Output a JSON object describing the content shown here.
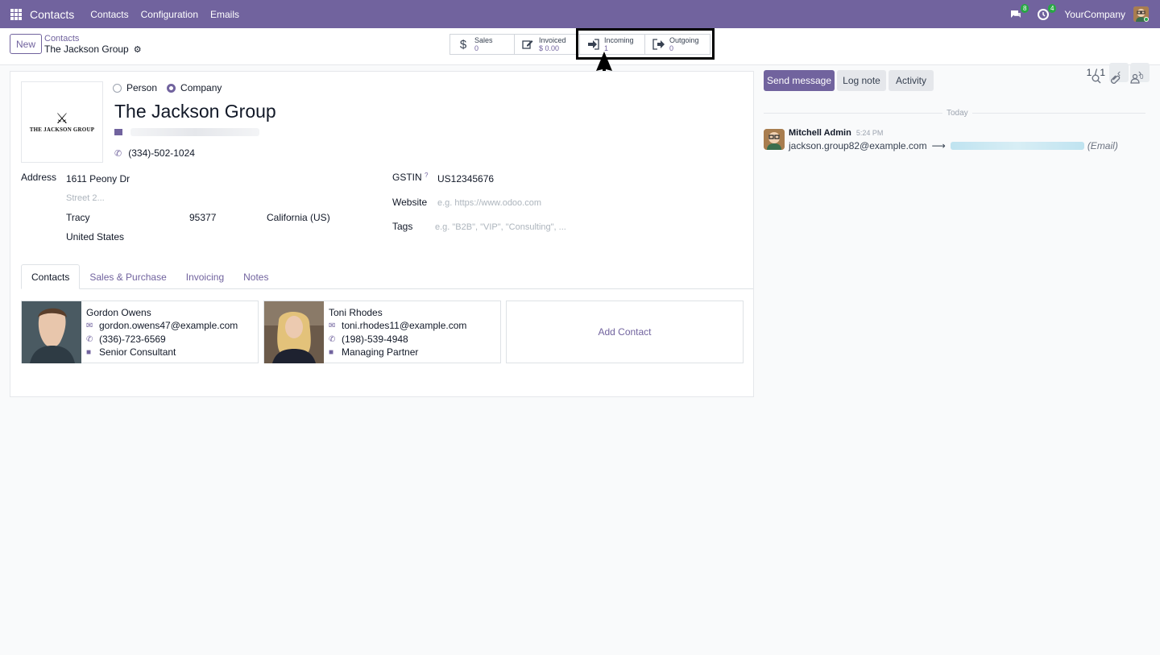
{
  "navbar": {
    "app_name": "Contacts",
    "menu": [
      "Contacts",
      "Configuration",
      "Emails"
    ],
    "messages_count": "8",
    "activities_count": "4",
    "company": "YourCompany"
  },
  "control": {
    "new_label": "New",
    "breadcrumb": "Contacts",
    "record_title": "The Jackson Group",
    "pager": "1 / 1",
    "smart_buttons": [
      {
        "label": "Sales",
        "value": "0",
        "icon": "dollar-icon"
      },
      {
        "label": "Invoiced",
        "value": "$ 0.00",
        "icon": "edit-icon"
      },
      {
        "label": "Incoming",
        "value": "1",
        "icon": "sign-in-icon"
      },
      {
        "label": "Outgoing",
        "value": "0",
        "icon": "sign-out-icon"
      }
    ]
  },
  "form": {
    "logo_text": "THE JACKSON GROUP",
    "type_person": "Person",
    "type_company": "Company",
    "name": "The Jackson Group",
    "phone": "(334)-502-1024",
    "address_label": "Address",
    "street": "1611 Peony Dr",
    "street2_placeholder": "Street 2...",
    "city": "Tracy",
    "zip": "95377",
    "state": "California (US)",
    "country": "United States",
    "gstin_label": "GSTIN",
    "gstin_help": "?",
    "gstin": "US12345676",
    "website_label": "Website",
    "website_placeholder": "e.g. https://www.odoo.com",
    "tags_label": "Tags",
    "tags_placeholder": "e.g. \"B2B\", \"VIP\", \"Consulting\", ..."
  },
  "tabs": [
    "Contacts",
    "Sales & Purchase",
    "Invoicing",
    "Notes"
  ],
  "contacts": [
    {
      "name": "Gordon Owens",
      "email": "gordon.owens47@example.com",
      "phone": "(336)-723-6569",
      "role": "Senior Consultant"
    },
    {
      "name": "Toni Rhodes",
      "email": "toni.rhodes11@example.com",
      "phone": "(198)-539-4948",
      "role": "Managing Partner"
    }
  ],
  "add_contact": "Add Contact",
  "chatter": {
    "send_message": "Send message",
    "log_note": "Log note",
    "activity": "Activity",
    "followers_count": "0",
    "today": "Today",
    "author": "Mitchell Admin",
    "time": "5:24 PM",
    "email_old": "jackson.group82@example.com",
    "arrow": "⟶",
    "field_name": "(Email)"
  }
}
